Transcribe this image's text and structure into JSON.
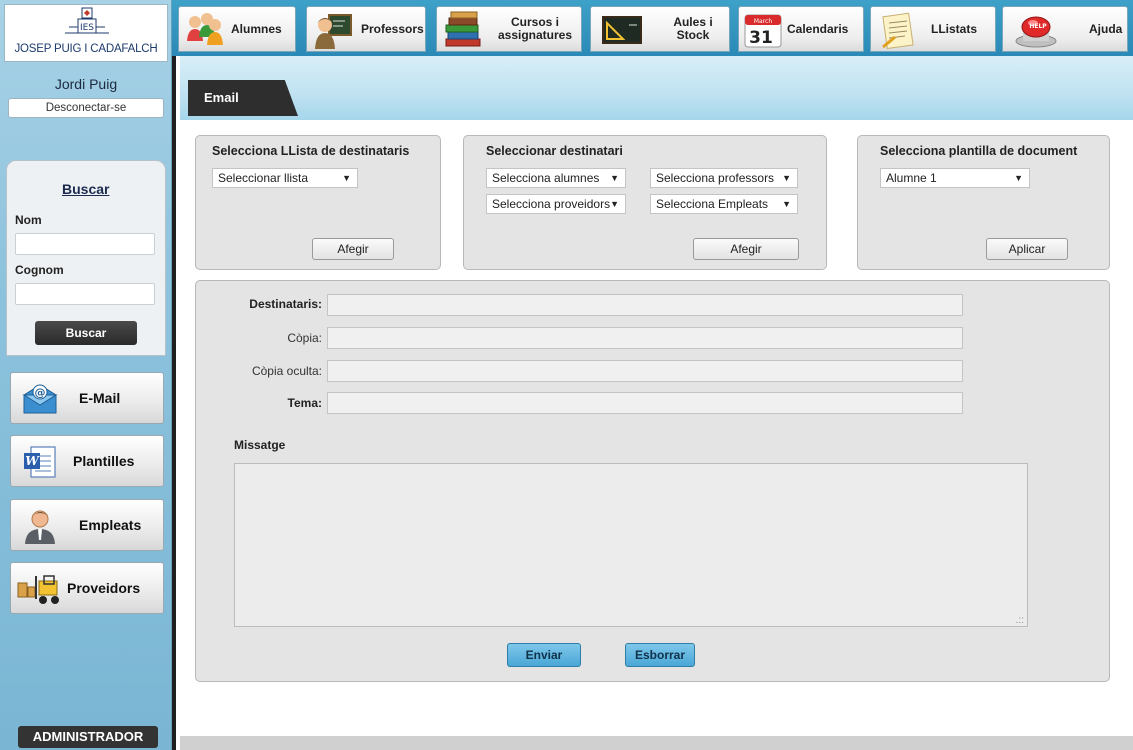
{
  "sidebar": {
    "logo_text": "JOSEP PUIG I CADAFALCH",
    "logo_mark": "IES",
    "user_name": "Jordi Puig",
    "logout_label": "Desconectar-se",
    "search": {
      "title": "Buscar",
      "name_label": "Nom",
      "surname_label": "Cognom",
      "name_value": "",
      "surname_value": "",
      "button_label": "Buscar"
    },
    "nav": [
      {
        "label": "E-Mail",
        "icon": "email-icon"
      },
      {
        "label": "Plantilles",
        "icon": "word-document-icon"
      },
      {
        "label": "Empleats",
        "icon": "employee-icon"
      },
      {
        "label": "Proveidors",
        "icon": "forklift-icon"
      }
    ],
    "role_badge": "ADMINISTRADOR"
  },
  "toolbar": {
    "items": [
      {
        "label": "Alumnes",
        "icon": "students-icon"
      },
      {
        "label": "Professors",
        "icon": "teacher-icon"
      },
      {
        "label": "Cursos i assignatures",
        "line1": "Cursos i",
        "line2": "assignatures",
        "icon": "books-icon"
      },
      {
        "label": "Aules i Stock",
        "line1": "Aules i",
        "line2": "Stock",
        "icon": "blackboard-icon"
      },
      {
        "label": "Calendaris",
        "icon": "calendar-icon",
        "calendar_day": "31",
        "calendar_month": "March"
      },
      {
        "label": "LListats",
        "icon": "list-icon"
      },
      {
        "label": "Ajuda",
        "icon": "help-icon",
        "badge": "HELP"
      }
    ]
  },
  "tab": {
    "label": "Email"
  },
  "panels": {
    "list": {
      "title": "Selecciona LLista de destinataris",
      "select_value": "Seleccionar llista",
      "button_label": "Afegir"
    },
    "recipient": {
      "title": "Seleccionar destinatari",
      "selects": [
        "Selecciona alumnes",
        "Selecciona professors",
        "Selecciona proveidors",
        "Selecciona Empleats"
      ],
      "button_label": "Afegir"
    },
    "template": {
      "title": "Selecciona plantilla de document",
      "select_value": "Alumne 1",
      "button_label": "Aplicar"
    }
  },
  "compose": {
    "to_label": "Destinataris:",
    "cc_label": "Còpia:",
    "bcc_label": "Còpia oculta:",
    "subject_label": "Tema:",
    "to_value": "",
    "cc_value": "",
    "bcc_value": "",
    "subject_value": "",
    "message_label": "Missatge",
    "message_value": "",
    "send_label": "Enviar",
    "clear_label": "Esborrar"
  },
  "colors": {
    "sidebar_bg": "#8cc2dc",
    "toolbar_bg": "#2a89b6",
    "tab_active": "#2e2e2e",
    "panel_bg": "#e4e4e4",
    "primary_button": "#4aa7d6"
  }
}
